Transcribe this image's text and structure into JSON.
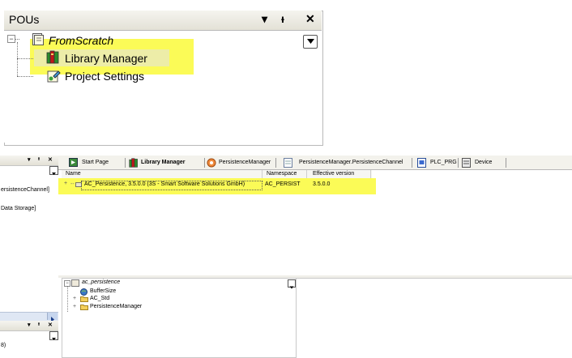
{
  "pou_panel": {
    "title": "POUs",
    "controls": {
      "dropdown": "▾",
      "pin": "ᵻ",
      "close": "✕"
    },
    "tree": {
      "root_label": "FromScratch",
      "children": [
        {
          "label": "Library Manager",
          "icon": "library-books-icon"
        },
        {
          "label": "Project Settings",
          "icon": "project-settings-icon"
        }
      ]
    }
  },
  "left_dock": {
    "top_header_controls": {
      "dropdown": "▾",
      "pin": "ᵻ",
      "close": "✕"
    },
    "items": [
      "ersistenceChannel]",
      "Data Storage]"
    ],
    "bottom_header_controls": {
      "dropdown": "▾",
      "pin": "ᵻ",
      "close": "✕"
    },
    "bottom_item": "8)"
  },
  "tabs": [
    {
      "label": "Start Page",
      "icon": "start-page-icon",
      "active": false
    },
    {
      "label": "Library Manager",
      "icon": "library-books-icon",
      "active": true
    },
    {
      "label": "PersistenceManager",
      "icon": "persistence-icon",
      "active": false
    },
    {
      "label": "PersistenceManager.PersistenceChannel",
      "icon": "document-icon",
      "active": false
    },
    {
      "label": "PLC_PRG",
      "icon": "program-icon",
      "active": false
    },
    {
      "label": "Device",
      "icon": "device-icon",
      "active": false
    }
  ],
  "library_grid": {
    "columns": [
      "Name",
      "Namespace",
      "Effective version"
    ],
    "rows": [
      {
        "name": "AC_Persistence, 3.5.0.0 (3S - Smart Software Solutions GmbH)",
        "namespace": "AC_PERSIST",
        "version": "3.5.0.0"
      }
    ]
  },
  "lower_tree": {
    "root": "ac_persistence",
    "items": [
      "BufferSize",
      "AC_Std",
      "PersistenceManager"
    ]
  },
  "colors": {
    "highlight": "#fbfb57",
    "panel_border": "#b9b9b9"
  }
}
